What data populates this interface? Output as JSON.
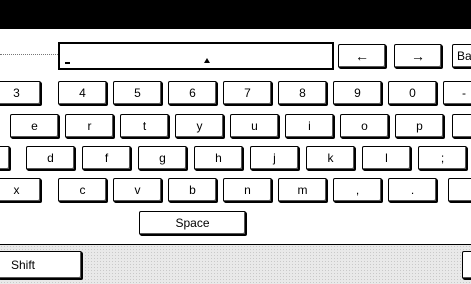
{
  "input": {
    "value": "",
    "cursor_glyph": "_"
  },
  "keys": {
    "left_arrow": "←",
    "right_arrow": "→",
    "backspace": "Ba",
    "row_numbers": [
      "3",
      "4",
      "5",
      "6",
      "7",
      "8",
      "9",
      "0",
      "-"
    ],
    "row_top": [
      "e",
      "r",
      "t",
      "y",
      "u",
      "i",
      "o",
      "p"
    ],
    "row_home": [
      "d",
      "f",
      "g",
      "h",
      "j",
      "k",
      "l",
      ";"
    ],
    "row_bottom": [
      "x",
      "c",
      "v",
      "b",
      "n",
      "m",
      ",",
      "."
    ],
    "space": "Space",
    "shift": "Shift"
  }
}
